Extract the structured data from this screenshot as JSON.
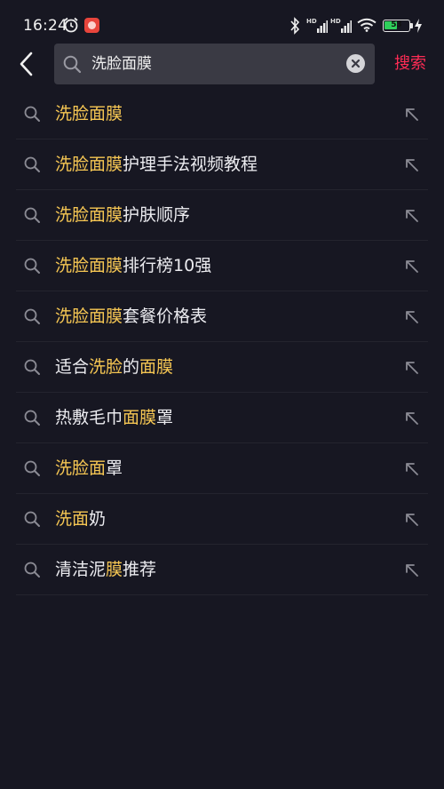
{
  "status_bar": {
    "time": "16:24",
    "signal_label": "HD",
    "battery_level": "53",
    "battery_percent": 53
  },
  "search": {
    "query": "洗脸面膜",
    "submit_label": "搜索"
  },
  "colors": {
    "accent": "#fe2c55",
    "highlight": "#f5c653",
    "background": "#171722"
  },
  "icons": {
    "back": "chevron-left-icon",
    "search": "search-icon",
    "clear": "clear-icon",
    "fill": "fill-arrow-icon"
  },
  "suggestions": [
    [
      {
        "t": "洗脸面膜",
        "h": true
      }
    ],
    [
      {
        "t": "洗脸面膜",
        "h": true
      },
      {
        "t": "护理手法视频教程",
        "h": false
      }
    ],
    [
      {
        "t": "洗脸面膜",
        "h": true
      },
      {
        "t": "护肤顺序",
        "h": false
      }
    ],
    [
      {
        "t": "洗脸面膜",
        "h": true
      },
      {
        "t": "排行榜10强",
        "h": false
      }
    ],
    [
      {
        "t": "洗脸面膜",
        "h": true
      },
      {
        "t": "套餐价格表",
        "h": false
      }
    ],
    [
      {
        "t": "适合",
        "h": false
      },
      {
        "t": "洗脸",
        "h": true
      },
      {
        "t": "的",
        "h": false
      },
      {
        "t": "面膜",
        "h": true
      }
    ],
    [
      {
        "t": "热敷毛巾",
        "h": false
      },
      {
        "t": "面膜",
        "h": true
      },
      {
        "t": "罩",
        "h": false
      }
    ],
    [
      {
        "t": "洗脸面",
        "h": true
      },
      {
        "t": "罩",
        "h": false
      }
    ],
    [
      {
        "t": "洗面",
        "h": true
      },
      {
        "t": "奶",
        "h": false
      }
    ],
    [
      {
        "t": "清洁泥",
        "h": false
      },
      {
        "t": "膜",
        "h": true
      },
      {
        "t": "推荐",
        "h": false
      }
    ]
  ]
}
